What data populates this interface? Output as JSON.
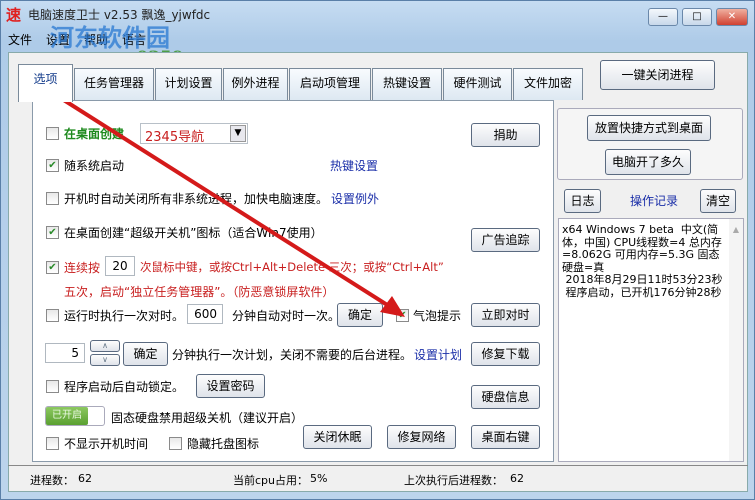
{
  "window": {
    "title": "电脑速度卫士 v2.53 飘逸_yjwfdc",
    "logo_char": "速",
    "controls": [
      "minimize",
      "maximize",
      "close"
    ]
  },
  "menu": [
    "文件",
    "设置",
    "帮助",
    "语言"
  ],
  "watermark": {
    "name": "河东软件园",
    "url": "www.pc0359.cn"
  },
  "tabs": [
    "选项",
    "任务管理器",
    "计划设置",
    "例外进程",
    "启动项管理",
    "热键设置",
    "硬件测试",
    "文件加密"
  ],
  "top_button": "一键关闭进程",
  "options": {
    "create_desktop": {
      "label": "在桌面创建",
      "checked": false,
      "select_value": "2345导航"
    },
    "donate": "捐助",
    "autostart": {
      "label": "随系统启动",
      "checked": true
    },
    "hotkey_link": "热键设置",
    "close_nonsys": {
      "label": "开机时自动关闭所有非系统进程，加快电脑速度。",
      "checked": false
    },
    "exception_link": "设置例外",
    "super_switch": {
      "label": "在桌面创建“超级开关机”图标（适合Win7使用）",
      "checked": true
    },
    "ad_track": "广告追踪",
    "continuous": {
      "label_a": "连续按",
      "value": "20",
      "label_b": "次鼠标中键，或按Ctrl+Alt+Delete 三次；或按“Ctrl+Alt”",
      "label_c": "五次，启动“独立任务管理器”。（防恶意锁屏软件）",
      "checked": true
    },
    "sync_time": {
      "label": "运行时执行一次对时。",
      "value": "600",
      "label_b": "分钟自动对时一次。",
      "confirm": "确定",
      "checked": false
    },
    "bubble": {
      "label": "气泡提示",
      "checked": true
    },
    "sync_now": "立即对时",
    "plan": {
      "value": "5",
      "confirm": "确定",
      "label": "分钟执行一次计划，关闭不需要的后台进程。",
      "link": "设置计划"
    },
    "repair_download": "修复下载",
    "auto_lock": {
      "label": "程序启动后自动锁定。",
      "checked": false
    },
    "set_password": "设置密码",
    "disk_info": "硬盘信息",
    "ssd_toggle": {
      "state": "已开启",
      "label": "固态硬盘禁用超级关机（建议开启）"
    },
    "hide_boot_time": {
      "label": "不显示开机时间",
      "checked": false
    },
    "hide_tray": {
      "label": "隐藏托盘图标",
      "checked": false
    },
    "close_hibernate": "关闭休眠",
    "repair_network": "修复网络",
    "desktop_rightclick": "桌面右键"
  },
  "right": {
    "shortcut": "放置快捷方式到桌面",
    "uptime": "电脑开了多久",
    "log_btn": "日志",
    "log_title": "操作记录",
    "clear": "清空",
    "log_text": "x64 Windows 7 beta  中文(简体，中国) CPU线程数=4 总内存=8.062G 可用内存=5.3G 固态硬盘=真\n 2018年8月29日11时53分23秒\n 程序启动，已开机176分钟28秒"
  },
  "status": {
    "proc_label": "进程数：",
    "proc": "62",
    "cpu_label": "当前cpu占用：",
    "cpu": "5%",
    "last_label": "上次执行后进程数：",
    "last": "62"
  }
}
